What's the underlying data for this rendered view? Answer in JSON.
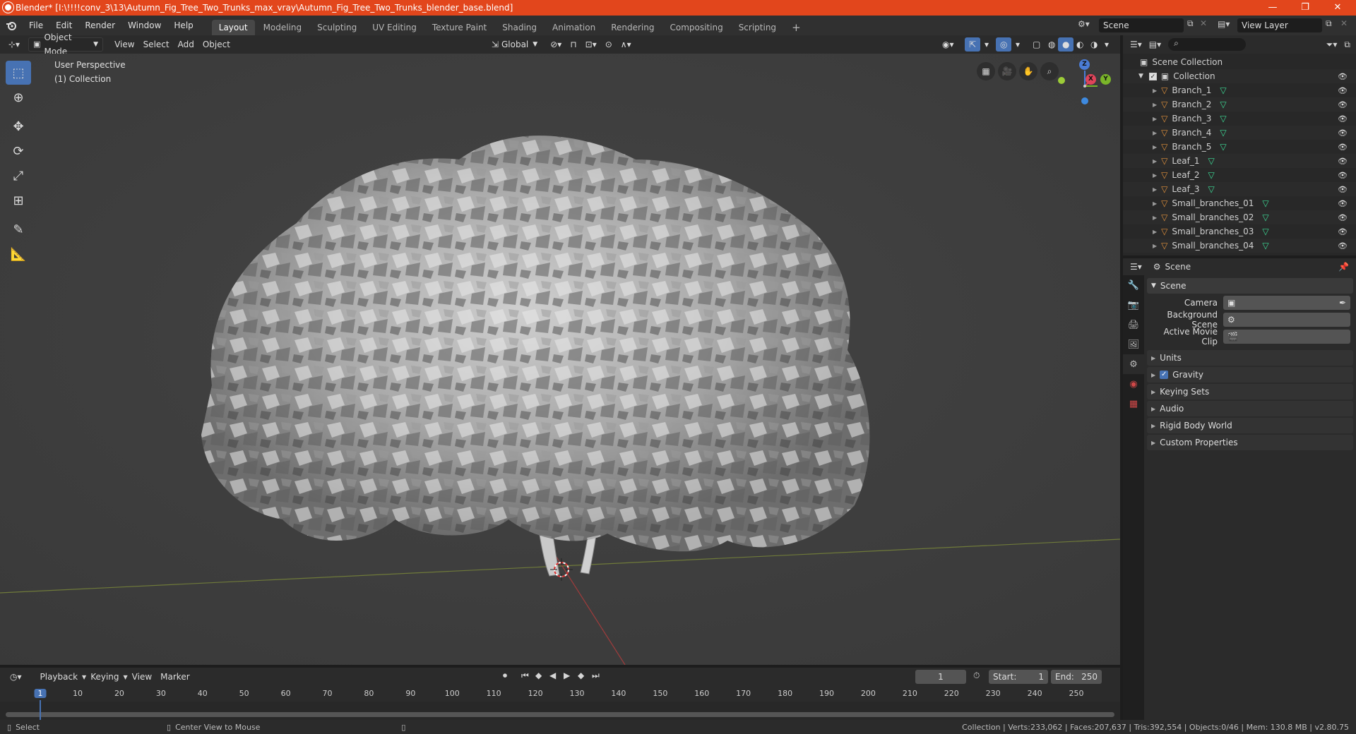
{
  "window": {
    "title": "Blender* [I:\\!!!!conv_3\\13\\Autumn_Fig_Tree_Two_Trunks_max_vray\\Autumn_Fig_Tree_Two_Trunks_blender_base.blend]",
    "minimize": "—",
    "maximize": "❐",
    "close": "✕"
  },
  "menu": [
    "File",
    "Edit",
    "Render",
    "Window",
    "Help"
  ],
  "workspaces": [
    "Layout",
    "Modeling",
    "Sculpting",
    "UV Editing",
    "Texture Paint",
    "Shading",
    "Animation",
    "Rendering",
    "Compositing",
    "Scripting"
  ],
  "workspace_add": "+",
  "scene_field": "Scene",
  "view_layer_field": "View Layer",
  "viewport_header": {
    "mode": "Object Mode",
    "menus": [
      "View",
      "Select",
      "Add",
      "Object"
    ],
    "transform": "Global"
  },
  "viewport": {
    "perspective": "User Perspective",
    "collection": "(1) Collection",
    "gizmo": {
      "z": "Z",
      "x": "X",
      "y": "Y"
    }
  },
  "outliner": {
    "root": "Scene Collection",
    "collection": "Collection",
    "items": [
      "Branch_1",
      "Branch_2",
      "Branch_3",
      "Branch_4",
      "Branch_5",
      "Leaf_1",
      "Leaf_2",
      "Leaf_3",
      "Small_branches_01",
      "Small_branches_02",
      "Small_branches_03",
      "Small_branches_04"
    ]
  },
  "properties": {
    "context": "Scene",
    "section": "Scene",
    "fields": [
      {
        "label": "Camera",
        "value": ""
      },
      {
        "label": "Background Scene",
        "value": ""
      },
      {
        "label": "Active Movie Clip",
        "value": ""
      }
    ],
    "panels": [
      "Units",
      "Gravity",
      "Keying Sets",
      "Audio",
      "Rigid Body World",
      "Custom Properties"
    ],
    "gravity_checked": true
  },
  "timeline": {
    "menus": [
      "Playback",
      "Keying",
      "View",
      "Marker"
    ],
    "current_frame": "1",
    "start_label": "Start:",
    "start": "1",
    "end_label": "End:",
    "end": "250",
    "ticks": [
      "1",
      "10",
      "20",
      "30",
      "40",
      "50",
      "60",
      "70",
      "80",
      "90",
      "100",
      "110",
      "120",
      "130",
      "140",
      "150",
      "160",
      "170",
      "180",
      "190",
      "200",
      "210",
      "220",
      "230",
      "240",
      "250"
    ]
  },
  "status": {
    "left": "Select",
    "middle": "Center View to Mouse",
    "right": "Collection | Verts:233,062 | Faces:207,637 | Tris:392,554 | Objects:0/46 | Mem: 130.8 MB | v2.80.75"
  },
  "colors": {
    "titlebar": "#e2461c",
    "accent": "#4772b3",
    "mesh_icon": "#e0913c",
    "data_icon": "#3ddc97"
  }
}
